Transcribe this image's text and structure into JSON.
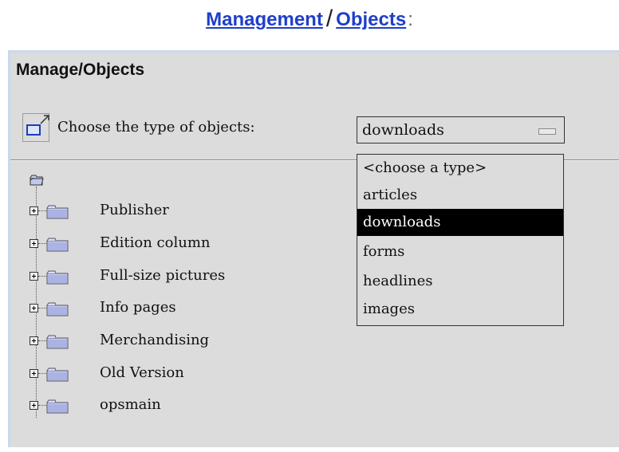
{
  "breadcrumb": {
    "management": "Management",
    "separator": "/",
    "objects": "Objects",
    "colon": ":"
  },
  "panel": {
    "title": "Manage/Objects"
  },
  "toolbar": {
    "popout_icon": "window-popout-icon",
    "choose_label": "Choose the type of objects:",
    "selected_type": "downloads"
  },
  "dropdown": {
    "options": [
      {
        "label": "<choose a type>",
        "selected": false
      },
      {
        "label": "articles",
        "selected": false
      },
      {
        "label": "downloads",
        "selected": true
      },
      {
        "label": "forms",
        "selected": false
      },
      {
        "label": "headlines",
        "selected": false
      },
      {
        "label": "images",
        "selected": false
      }
    ]
  },
  "tree": {
    "root_icon": "folder-open-icon",
    "items": [
      {
        "label": "Publisher"
      },
      {
        "label": "Edition column"
      },
      {
        "label": "Full-size pictures"
      },
      {
        "label": "Info pages"
      },
      {
        "label": "Merchandising"
      },
      {
        "label": "Old Version"
      },
      {
        "label": "opsmain"
      }
    ]
  },
  "colors": {
    "link": "#1f3fc9",
    "panel_bg": "#dcdcdc",
    "panel_border": "#c9d8ec",
    "selection_bg": "#000000"
  }
}
